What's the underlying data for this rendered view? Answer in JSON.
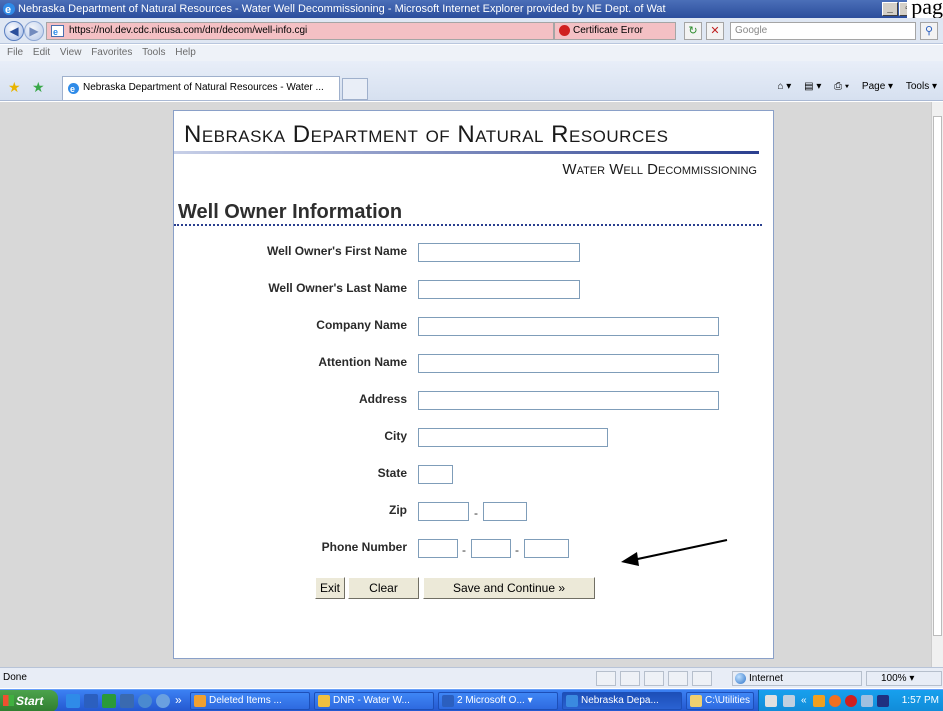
{
  "window": {
    "title": "Nebraska Department of Natural Resources - Water Well Decommissioning - Microsoft Internet Explorer provided by NE Dept. of Wat",
    "minimize": "_",
    "restore": "▫",
    "close": "x",
    "overlay_text": "pag"
  },
  "nav": {
    "back_icon": "back-arrow-icon",
    "forward_icon": "forward-arrow-icon",
    "url": "https://nol.dev.cdc.nicusa.com/dnr/decom/well-info.cgi",
    "certificate_error": "Certificate Error",
    "search_placeholder": "Google",
    "refresh_glyph": "↻",
    "stop_glyph": "✕",
    "search_glyph": "⚲"
  },
  "menu": [
    "File",
    "Edit",
    "View",
    "Favorites",
    "Tools",
    "Help"
  ],
  "tab": {
    "label": "Nebraska Department of Natural Resources - Water ..."
  },
  "commands": {
    "home": "⌂ ▾",
    "feeds": "▤ ▾",
    "print": "⎙ ▾",
    "page": "Page ▾",
    "tools": "Tools ▾"
  },
  "page": {
    "banner_title": "Nebraska Department of Natural Resources",
    "banner_subtitle": "Water Well Decommissioning",
    "section_title": "Well Owner Information",
    "fields": {
      "first_name": {
        "label": "Well Owner's First Name",
        "value": ""
      },
      "last_name": {
        "label": "Well Owner's Last Name",
        "value": ""
      },
      "company": {
        "label": "Company Name",
        "value": ""
      },
      "attention": {
        "label": "Attention Name",
        "value": ""
      },
      "address": {
        "label": "Address",
        "value": ""
      },
      "city": {
        "label": "City",
        "value": ""
      },
      "state": {
        "label": "State",
        "value": ""
      },
      "zip": {
        "label": "Zip",
        "value": ""
      },
      "phone": {
        "label": "Phone Number",
        "value": ""
      }
    },
    "dash": "-",
    "buttons": {
      "exit": "Exit",
      "clear": "Clear",
      "save": "Save and Continue »"
    }
  },
  "status": {
    "text": "Done",
    "zone": "Internet",
    "zoom": "100%"
  },
  "taskbar": {
    "start": "Start",
    "chevron": "»",
    "tasks": [
      {
        "label": "Deleted Items ...",
        "color": "#f0a030"
      },
      {
        "label": "DNR - Water W...",
        "color": "#f0c040"
      },
      {
        "label": "2 Microsoft O... ▾",
        "color": "#2b5fbf"
      },
      {
        "label": "Nebraska Depa...",
        "color": "#3a8ae0"
      },
      {
        "label": "C:\\Utilities",
        "color": "#f0d070"
      }
    ],
    "tray_chevron": "«",
    "clock": "1:57 PM"
  },
  "colors": {
    "accent": "#2a3f8f",
    "address_error": "#f4c0c4"
  }
}
